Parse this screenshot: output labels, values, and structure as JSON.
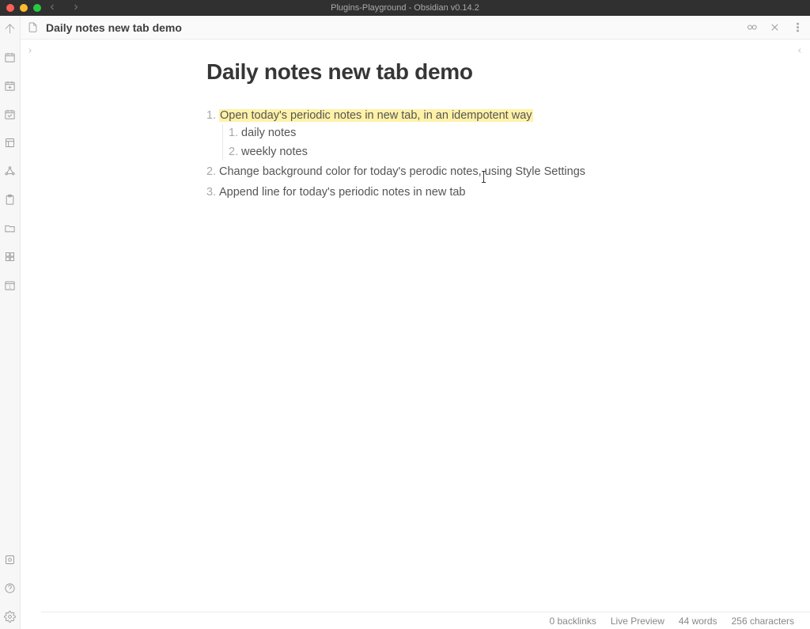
{
  "titlebar": {
    "title": "Plugins-Playground - Obsidian v0.14.2"
  },
  "tab": {
    "title": "Daily notes new tab demo"
  },
  "document": {
    "heading": "Daily notes new tab demo",
    "list": [
      {
        "text": "Open today's periodic notes in new tab, in an idempotent way",
        "highlighted": true,
        "sub": [
          {
            "text": "daily notes"
          },
          {
            "text": "weekly notes"
          }
        ]
      },
      {
        "text": "Change background color for today's perodic notes, using Style Settings"
      },
      {
        "text": "Append line for today's periodic notes in new tab"
      }
    ]
  },
  "status": {
    "backlinks": "0 backlinks",
    "mode": "Live Preview",
    "words": "44 words",
    "characters": "256 characters"
  }
}
